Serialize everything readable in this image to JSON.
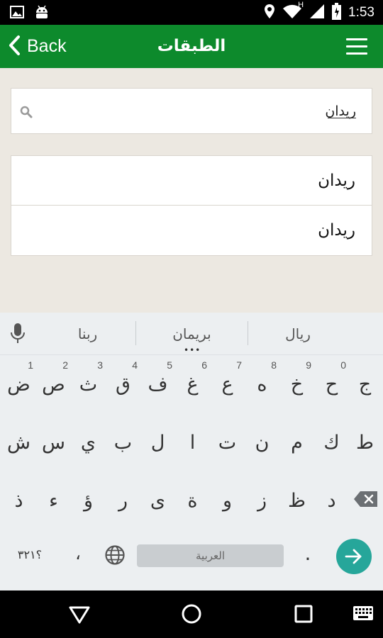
{
  "status": {
    "time": "1:53",
    "icons": [
      "image-icon",
      "android-icon",
      "location-icon",
      "wifi-icon",
      "signal-icon",
      "battery-icon"
    ],
    "network_label": "H"
  },
  "header": {
    "back_label": "Back",
    "title": "الطبقات",
    "color": "#0D8A2C"
  },
  "search": {
    "value": "ريدان",
    "icon": "search-icon"
  },
  "results": [
    {
      "label": "ريدان"
    },
    {
      "label": "ريدان"
    }
  ],
  "keyboard": {
    "suggestions": [
      "ربنا",
      "بريمان",
      "ريال"
    ],
    "more_indicator": "•••",
    "row1": [
      {
        "key": "ض",
        "hint": "1"
      },
      {
        "key": "ص",
        "hint": "2"
      },
      {
        "key": "ث",
        "hint": "3"
      },
      {
        "key": "ق",
        "hint": "4"
      },
      {
        "key": "ف",
        "hint": "5"
      },
      {
        "key": "غ",
        "hint": "6"
      },
      {
        "key": "ع",
        "hint": "7"
      },
      {
        "key": "ه",
        "hint": "8"
      },
      {
        "key": "خ",
        "hint": "9"
      },
      {
        "key": "ح",
        "hint": "0"
      },
      {
        "key": "ج",
        "hint": ""
      }
    ],
    "row2": [
      "ش",
      "س",
      "ي",
      "ب",
      "ل",
      "ا",
      "ت",
      "ن",
      "م",
      "ك",
      "ط"
    ],
    "row3": [
      "ذ",
      "ء",
      "ؤ",
      "ر",
      "ى",
      "ة",
      "و",
      "ز",
      "ظ",
      "د"
    ],
    "symbols_label": "؟٣٢١",
    "comma_label": "،",
    "space_label": "العربية",
    "period_label": ".",
    "accent_color": "#26A69A"
  },
  "navbar": {
    "icons": [
      "back-triangle-icon",
      "home-circle-icon",
      "recents-square-icon",
      "keyboard-icon"
    ]
  }
}
